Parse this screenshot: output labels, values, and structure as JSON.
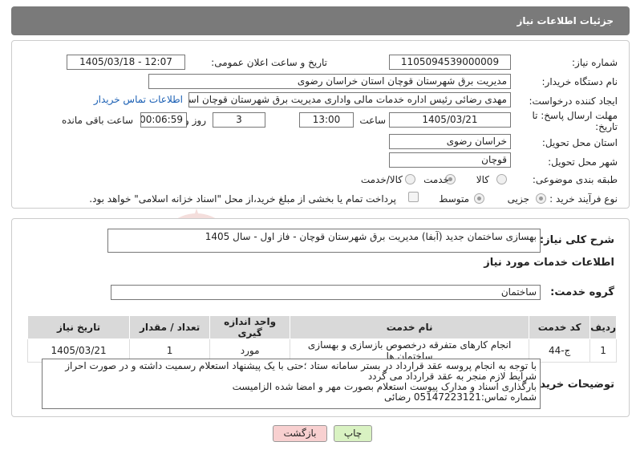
{
  "header": {
    "title": "جزئیات اطلاعات نیاز"
  },
  "form": {
    "need_number_label": "شماره نیاز:",
    "need_number": "1105094539000009",
    "announce_label": "تاریخ و ساعت اعلان عمومی:",
    "announce_value": "1405/03/18 - 12:07",
    "buyer_label": "نام دستگاه خریدار:",
    "buyer_value": "مدیریت برق شهرستان قوچان استان خراسان رضوی",
    "creator_label": "ایجاد کننده درخواست:",
    "creator_value": "مهدی رضائی رئیس اداره خدمات مالی واداری مدیریت برق شهرستان قوچان است",
    "contact_link": "اطلاعات تماس خریدار",
    "deadline_label_1": "مهلت ارسال پاسخ: تا",
    "deadline_label_2": "تاریخ:",
    "deadline_date": "1405/03/21",
    "time_label": "ساعت",
    "deadline_time": "13:00",
    "days_value": "3",
    "days_label": "روز و",
    "remaining_time": "00:06:59",
    "remaining_label": "ساعت باقی مانده",
    "province_label": "استان محل تحویل:",
    "province_value": "خراسان رضوی",
    "city_label": "شهر محل تحویل:",
    "city_value": "قوچان",
    "category_label": "طبقه بندی موضوعی:",
    "category_options": [
      "کالا",
      "خدمت",
      "کالا/خدمت"
    ],
    "category_selected": "خدمت",
    "process_label": "نوع فرآیند خرید :",
    "process_options": [
      "جزیی",
      "متوسط"
    ],
    "process_selected": "جزیی",
    "payment_note": "پرداخت تمام یا بخشی از مبلغ خرید،از محل \"اسناد خزانه اسلامی\" خواهد بود."
  },
  "details": {
    "summary_label": "شرح کلی نیاز:",
    "summary_value": "بهسازی ساختمان جدید (آبفا) مدیریت برق شهرستان قوچان - فاز اول - سال 1405",
    "services_heading": "اطلاعات خدمات مورد نیاز",
    "service_group_label": "گروه خدمت:",
    "service_group_value": "ساختمان",
    "table": {
      "headers": [
        "ردیف",
        "کد خدمت",
        "نام خدمت",
        "واحد اندازه گیری",
        "تعداد / مقدار",
        "تاریخ نیاز"
      ],
      "rows": [
        [
          "1",
          "ج-44",
          "انجام کارهای متفرقه درخصوص بازسازی و بهسازی ساختمان ها",
          "مورد",
          "1",
          "1405/03/21"
        ]
      ]
    },
    "notes_label": "توضیحات خریدار:",
    "notes_lines": [
      "با توجه به انجام پروسه عقد قرارداد در بستر سامانه ستاد ؛حتی با یک پیشنهاد استعلام رسمیت داشته و در صورت احراز",
      "شرایط لازم منجر به عقد قرارداد می گردد",
      "بارگذاری اسناد و مدارک پیوست استعلام بصورت مهر و امضا شده الزامیست",
      "شماره تماس:05147223121 رضائی"
    ]
  },
  "buttons": {
    "print": "چاپ",
    "back": "بازگشت"
  },
  "watermark": {
    "text": "AriaTender.net",
    "color": "#c0392b"
  }
}
